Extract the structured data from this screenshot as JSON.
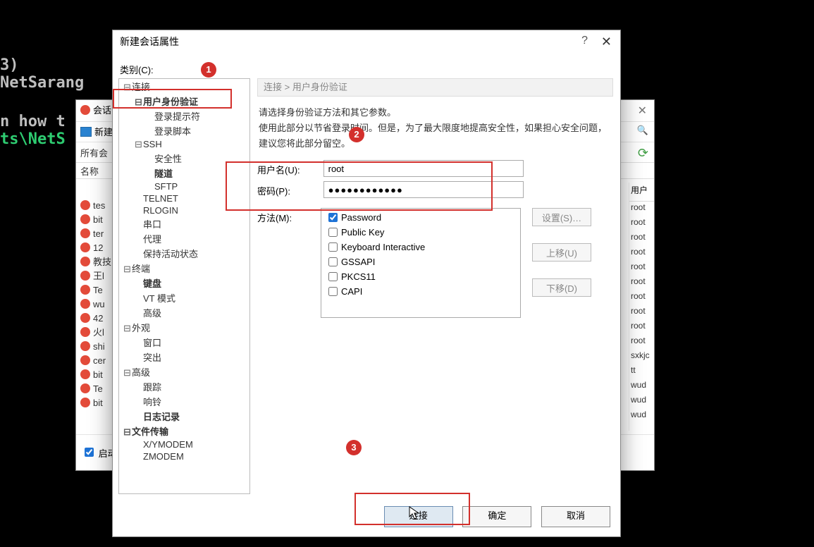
{
  "terminal": {
    "line1": "3)",
    "line2": "NetSarang",
    "line3": "n how t",
    "path": "ts\\NetS"
  },
  "bgdlg": {
    "title": "会话",
    "new": "新建",
    "all": "所有会",
    "col1": "名称",
    "colR": "用户",
    "rows": [
      "tes",
      "bit",
      "ter",
      "12",
      "教技",
      "王l",
      "Te",
      "wu",
      "42",
      "火l",
      "shi",
      "cer",
      "bit",
      "Te",
      "bit"
    ],
    "users": [
      "root",
      "root",
      "root",
      "root",
      "root",
      "root",
      "root",
      "root",
      "root",
      "root",
      "sxkjc",
      "tt",
      "wud",
      "wud",
      "wud"
    ],
    "startup_chk": "启动"
  },
  "dlg": {
    "title": "新建会话属性",
    "cat_label": "类别(C):",
    "breadcrumb": "连接 > 用户身份验证",
    "desc1": "请选择身份验证方法和其它参数。",
    "desc2": "使用此部分以节省登录时间。但是，为了最大限度地提高安全性，如果担心安全问题，建议您将此部分留空。",
    "user_label": "用户名(U):",
    "user_value": "root",
    "pass_label": "密码(P):",
    "pass_value": "●●●●●●●●●●●●",
    "method_label": "方法(M):",
    "methods": {
      "password": "Password",
      "publickey": "Public Key",
      "kbd": "Keyboard Interactive",
      "gssapi": "GSSAPI",
      "pkcs11": "PKCS11",
      "capi": "CAPI"
    },
    "settings_btn": "设置(S)…",
    "up_btn": "上移(U)",
    "down_btn": "下移(D)",
    "connect_btn": "连接",
    "ok_btn": "确定",
    "cancel_btn": "取消"
  },
  "tree": [
    {
      "l": 1,
      "t": "连接",
      "b": false,
      "exp": "-"
    },
    {
      "l": 2,
      "t": "用户身份验证",
      "b": true,
      "exp": "-"
    },
    {
      "l": 3,
      "t": "登录提示符",
      "b": false
    },
    {
      "l": 3,
      "t": "登录脚本",
      "b": false
    },
    {
      "l": 2,
      "t": "SSH",
      "b": false,
      "exp": "-"
    },
    {
      "l": 3,
      "t": "安全性",
      "b": false
    },
    {
      "l": 3,
      "t": "隧道",
      "b": true
    },
    {
      "l": 3,
      "t": "SFTP",
      "b": false
    },
    {
      "l": 2,
      "t": "TELNET",
      "b": false
    },
    {
      "l": 2,
      "t": "RLOGIN",
      "b": false
    },
    {
      "l": 2,
      "t": "串口",
      "b": false
    },
    {
      "l": 2,
      "t": "代理",
      "b": false
    },
    {
      "l": 2,
      "t": "保持活动状态",
      "b": false
    },
    {
      "l": 1,
      "t": "终端",
      "b": false,
      "exp": "-"
    },
    {
      "l": 2,
      "t": "键盘",
      "b": true
    },
    {
      "l": 2,
      "t": "VT 模式",
      "b": false
    },
    {
      "l": 2,
      "t": "高级",
      "b": false
    },
    {
      "l": 1,
      "t": "外观",
      "b": false,
      "exp": "-"
    },
    {
      "l": 2,
      "t": "窗口",
      "b": false
    },
    {
      "l": 2,
      "t": "突出",
      "b": false
    },
    {
      "l": 1,
      "t": "高级",
      "b": false,
      "exp": "-"
    },
    {
      "l": 2,
      "t": "跟踪",
      "b": false
    },
    {
      "l": 2,
      "t": "响铃",
      "b": false
    },
    {
      "l": 2,
      "t": "日志记录",
      "b": true
    },
    {
      "l": 1,
      "t": "文件传输",
      "b": true,
      "exp": "-"
    },
    {
      "l": 2,
      "t": "X/YMODEM",
      "b": false
    },
    {
      "l": 2,
      "t": "ZMODEM",
      "b": false
    }
  ],
  "annotations": {
    "n1": "1",
    "n2": "2",
    "n3": "3"
  }
}
